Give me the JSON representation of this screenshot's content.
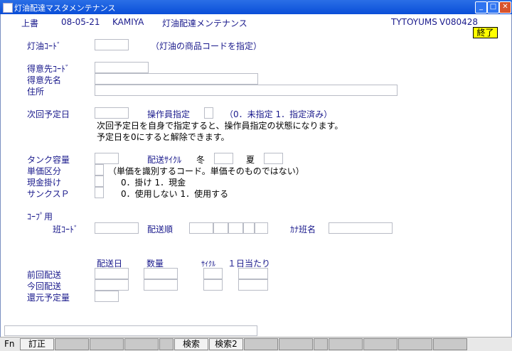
{
  "window": {
    "title": "灯油配達マスタメンテナンス"
  },
  "header": {
    "mode": "上書",
    "date": "08-05-21",
    "user": "KAMIYA",
    "screen_title": "灯油配達メンテナンス",
    "program_id": "TYTOYUMS",
    "version": "V080428",
    "end_button": "終了"
  },
  "form": {
    "kerosene_code_label": "灯油ｺｰﾄﾞ",
    "kerosene_code_hint": "（灯油の商品コードを指定）",
    "customer_code_label": "得意先ｺｰﾄﾞ",
    "customer_name_label": "得意先名",
    "address_label": "住所",
    "next_date_label": "次回予定日",
    "operator_label": "操作員指定",
    "operator_hint": "（0．未指定 1．指定済み）",
    "note_line1": "次回予定日を自身で指定すると、操作員指定の状態になります。",
    "note_line2": "予定日を0にすると解除できます。",
    "tank_label": "タンク容量",
    "cycle_label": "配送ｻｲｸﾙ",
    "winter_label": "冬",
    "summer_label": "夏",
    "price_class_label": "単価区分",
    "price_class_hint": "（単価を識別するコード。単価そのものではない）",
    "cash_label": "現金掛け",
    "cash_hint": "0．掛け 1．現金",
    "thanks_label": "サンクスＰ",
    "thanks_hint": "0．使用しない 1．使用する",
    "coop_label": "ｺｰﾌﾟ用",
    "group_code_label": "班ｺｰﾄﾞ",
    "delivery_order_label": "配送順",
    "kana_group_label": "ｶﾅ班名"
  },
  "delivery_table": {
    "headers": {
      "date": "配送日",
      "qty": "数量",
      "cycle": "ｻｲｸﾙ",
      "per_day": "１日当たり"
    },
    "rows": [
      "前回配送",
      "今回配送",
      "還元予定量"
    ]
  },
  "function_keys": {
    "fn_label": "Fn",
    "keys": [
      "訂正",
      "",
      "",
      "",
      "",
      "検索",
      "検索2",
      "",
      "",
      "",
      "",
      "",
      "",
      ""
    ]
  }
}
